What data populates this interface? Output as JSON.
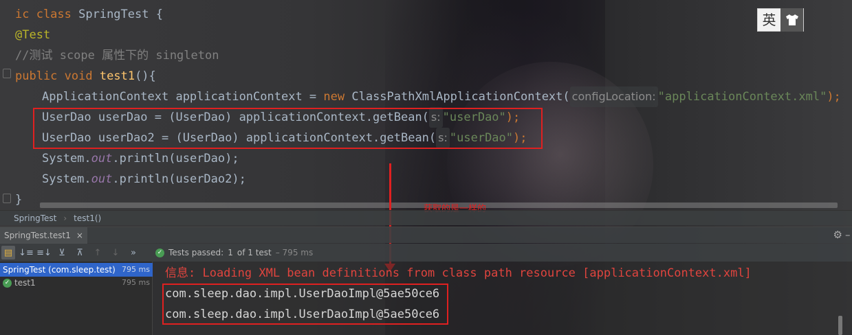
{
  "editor": {
    "lines": [
      {
        "pre": "",
        "kw": "ic class",
        "rest": " SpringTest {"
      },
      {
        "annotation": "@Test"
      },
      {
        "comment": "//测试 scope 属性下的 singleton"
      },
      {
        "kw1": "public",
        "kw2": "void",
        "fn": "test1",
        "rest": "(){"
      },
      {
        "text_a": "ApplicationContext applicationContext = ",
        "kw": "new",
        "text_b": " ClassPathXmlApplicationContext(",
        "hint": "configLocation:",
        "str": "\"applicationContext.xml\"",
        "end": ");"
      },
      {
        "text_a": "UserDao userDao = (UserDao) applicationContext.getBean(",
        "hint": "s:",
        "str": "\"userDao\"",
        "end": ");"
      },
      {
        "text_a": "UserDao userDao2 = (UserDao) applicationContext.getBean(",
        "hint": "s:",
        "str": "\"userDao\"",
        "end": ");"
      },
      {
        "text_a": "System.",
        "field": "out",
        "text_b": ".println(userDao);"
      },
      {
        "text_a": "System.",
        "field": "out",
        "text_b": ".println(userDao2);"
      },
      {
        "text_a": "}"
      }
    ],
    "annotation_note": "获取的是一样的"
  },
  "ime": {
    "char": "英",
    "icon": "tshirt-icon"
  },
  "breadcrumb": {
    "items": [
      "SpringTest",
      "test1()"
    ]
  },
  "run_panel": {
    "tab_label": "SpringTest.test1",
    "close_glyph": "×",
    "status": {
      "label": "Tests passed:",
      "count": "1",
      "of": "of 1 test",
      "duration": "– 795 ms"
    },
    "tree": [
      {
        "label": "SpringTest (com.sleep.test)",
        "time": "795 ms",
        "selected": true
      },
      {
        "label": "test1",
        "time": "795 ms",
        "selected": false
      }
    ],
    "console": [
      {
        "text": "信息: Loading XML bean definitions from class path resource [applicationContext.xml]",
        "kind": "err"
      },
      {
        "text": "com.sleep.dao.impl.UserDaoImpl@5ae50ce6",
        "kind": "out"
      },
      {
        "text": "com.sleep.dao.impl.UserDaoImpl@5ae50ce6",
        "kind": "out"
      }
    ]
  },
  "colors": {
    "highlight_box": "#e02020",
    "keyword": "#cc7832",
    "string": "#6a8759",
    "pass": "#499c54"
  }
}
